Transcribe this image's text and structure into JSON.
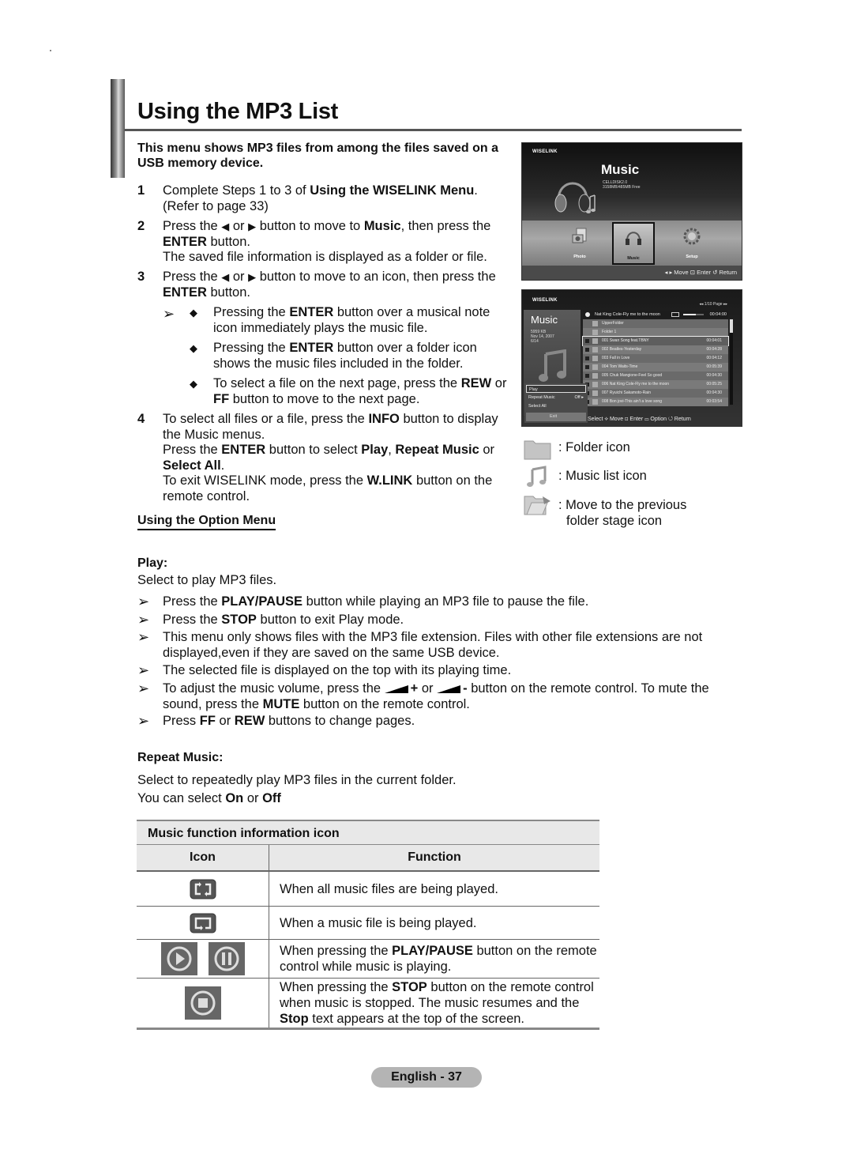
{
  "page": {
    "title": "Using the MP3 List",
    "intro": "This menu shows MP3 files from among the files saved on a USB memory device.",
    "footer": "English - 37"
  },
  "steps": [
    {
      "num": "1",
      "lines": [
        "Complete Steps 1 to 3 of ",
        "Using the WISELINK Menu",
        ".",
        "(Refer to page 33)"
      ]
    },
    {
      "num": "2",
      "a": "Press the ",
      "b": " or ",
      "c": " button to move to ",
      "d": "Music",
      "e": ", then press the",
      "f": "ENTER",
      "g": " button.",
      "h": "The saved file information is displayed as a folder or file."
    },
    {
      "num": "3",
      "a": "Press the ",
      "b": " or ",
      "c": " button to move to an icon, then press the",
      "f": "ENTER",
      "g": " button."
    },
    {
      "num": "4",
      "l1a": "To select all files or a file, press the ",
      "l1b": "INFO",
      "l1c": " button to display",
      "l2": "the Music menus.",
      "l3a": "Press the ",
      "l3b": "ENTER",
      "l3c": " button to select ",
      "l3d": "Play",
      "l3e": ", ",
      "l3f": "Repeat Music",
      "l3g": " or",
      "l4a": "Select All",
      "l4b": ".",
      "l5a": "To exit WISELINK mode, press the ",
      "l5b": "W.LINK",
      "l5c": " button on the",
      "l6": "remote control."
    }
  ],
  "bullets": [
    {
      "a": "Pressing the ",
      "b": "ENTER",
      "c": " button over a musical note",
      "d": "icon immediately plays the music file."
    },
    {
      "a": "Pressing the ",
      "b": "ENTER",
      "c": " button over a folder icon",
      "d": "shows the music files included in the folder."
    },
    {
      "a": "To select a file on the next page, press the ",
      "b": "REW",
      "c": " or",
      "d1": "FF",
      "d2": " button to move to the next page."
    }
  ],
  "option_menu_heading": "Using the Option Menu",
  "tv_home": {
    "logo": "WISELINK",
    "title": "Music",
    "disk_name": "CELLDISK2.0",
    "disk_free": "3158MB/485MB Free",
    "tiles": [
      {
        "label": "Photo",
        "selected": false
      },
      {
        "label": "Music",
        "selected": true
      },
      {
        "label": "Setup",
        "selected": false
      }
    ],
    "footer": "◂ ▸ Move   ⊡ Enter  ↺ Return"
  },
  "tv_list": {
    "logo": "WISELINK",
    "page": "◂◂ 1/10 Page ▸▸",
    "title": "Music",
    "meta": [
      "5959 KB",
      "Nov 14, 2007",
      "6/14"
    ],
    "now_playing": "Nat King Cole-Fly me to the moon",
    "now_time": "00:04:00",
    "progress": 0.6,
    "rows": [
      {
        "name": "UpperFolder",
        "time": "",
        "type": "upfolder"
      },
      {
        "name": "Folder 1",
        "time": "",
        "type": "folder"
      },
      {
        "name": "001 Swan Song feat.TBNY",
        "time": "00:04:01",
        "type": "music",
        "selected": true
      },
      {
        "name": "002 Beatles-Yesterday",
        "time": "00:04:28",
        "type": "music"
      },
      {
        "name": "003 Fall in Love",
        "time": "00:04:12",
        "type": "music"
      },
      {
        "name": "004 Tom Waits-Time",
        "time": "00:05:39",
        "type": "music"
      },
      {
        "name": "005 Chuk Mangione-Feel So good",
        "time": "00:04:30",
        "type": "music"
      },
      {
        "name": "006 Nat King Cole-Fly me to the moon",
        "time": "00:05:25",
        "type": "music"
      },
      {
        "name": "007 Ryuichi Sakamoto-Rain",
        "time": "00:04:30",
        "type": "music"
      },
      {
        "name": "008 Bon jovi-This ain't a love song",
        "time": "00:03:54",
        "type": "music"
      }
    ],
    "menu": [
      {
        "label": "Play",
        "value": "",
        "selected": true
      },
      {
        "label": "Repeat Music",
        "value": "Off ▸",
        "selected": false
      },
      {
        "label": "Select All",
        "value": "",
        "selected": false
      }
    ],
    "exit_label": "Exit",
    "footer": "Select  ⟡ Move  ⊡ Enter  ▭ Option  ↺ Return"
  },
  "legend": [
    {
      "icon": "folder-icon",
      "text": ": Folder icon"
    },
    {
      "icon": "music-list-icon",
      "text": ": Music list icon"
    },
    {
      "icon": "previous-folder-icon",
      "text1": ": Move to the previous",
      "text2": "folder stage icon"
    }
  ],
  "play": {
    "heading": "Play:",
    "desc": "Select to play MP3 files.",
    "notes": [
      {
        "a": "Press the ",
        "b": "PLAY/PAUSE",
        "c": " button while playing an MP3 file to pause the file."
      },
      {
        "a": "Press the ",
        "b": "STOP",
        "c": " button to exit Play mode."
      },
      {
        "a": "This menu only shows files with the MP3 file extension. Files with other file extensions are not",
        "c": "displayed,even if they are saved on the same USB device."
      },
      {
        "a": "The selected file is displayed on the top with its playing time."
      },
      {
        "a": "To adjust the music volume, press the ",
        "b1": "+",
        "m": " or ",
        "b2": "-",
        "c": " button on the remote control. To mute the",
        "d": "sound, press the ",
        "e": "MUTE",
        "f": " button on the remote control."
      },
      {
        "a": "Press ",
        "b": "FF",
        "m": " or ",
        "b2": "REW",
        "c": " buttons to change pages."
      }
    ]
  },
  "repeat": {
    "heading": "Repeat Music:",
    "desc": "Select to repeatedly play MP3 files in the current folder.",
    "sel_a": "You can select ",
    "sel_b": "On",
    "sel_c": " or ",
    "sel_d": "Off"
  },
  "table": {
    "title": "Music function information icon",
    "col_icon": "Icon",
    "col_function": "Function",
    "rows": [
      {
        "icons": [
          "repeat-all-icon"
        ],
        "text": "When all music files are being played."
      },
      {
        "icons": [
          "repeat-one-icon"
        ],
        "text": "When a music file is being played."
      },
      {
        "icons": [
          "play-icon",
          "pause-icon"
        ],
        "a": "When pressing the ",
        "b": "PLAY/PAUSE",
        "c": " button on the remote",
        "d": "control while music is playing."
      },
      {
        "icons": [
          "stop-icon"
        ],
        "a": "When pressing the ",
        "b": "STOP",
        "c": " button on the remote control",
        "d": "when music is stopped. The music resumes and the",
        "e": "Stop",
        "f": " text appears at the top of the screen."
      }
    ]
  }
}
